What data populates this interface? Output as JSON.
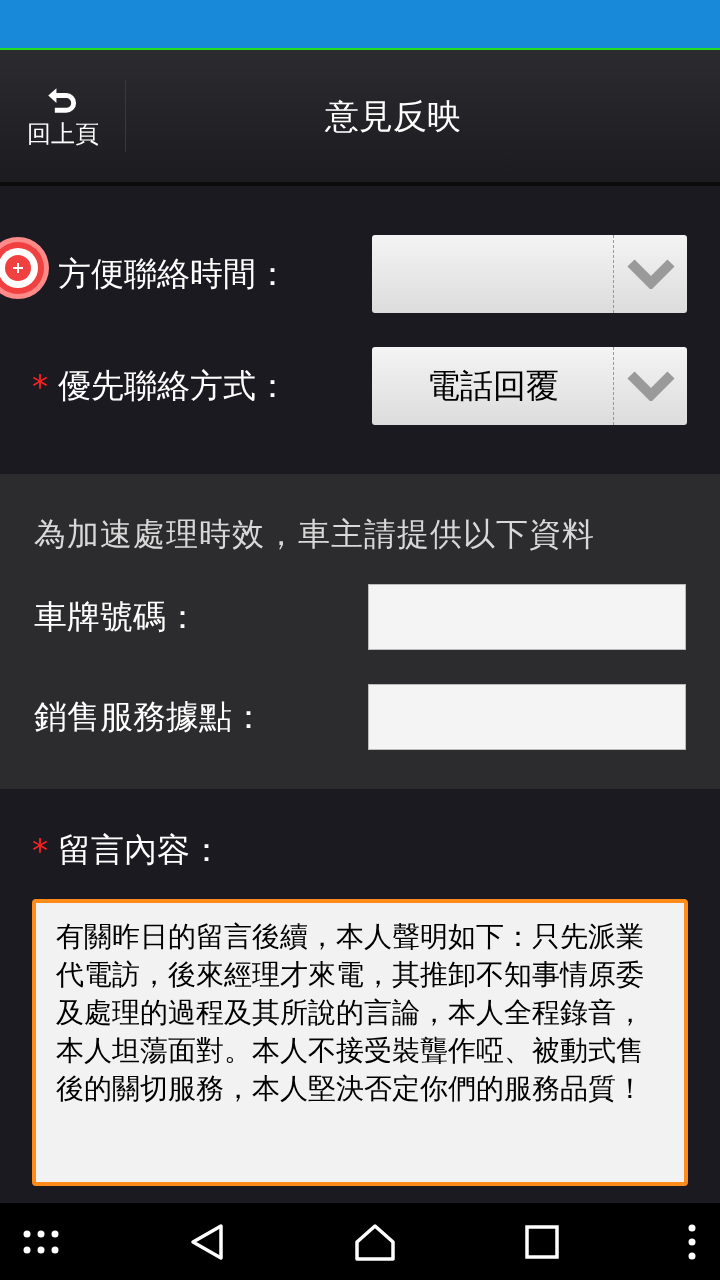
{
  "header": {
    "back_label": "回上頁",
    "title": "意見反映"
  },
  "contact_fields": [
    {
      "label": "方便聯絡時間："
    },
    {
      "label": "優先聯絡方式：",
      "required_marker": "*",
      "value": "電話回覆"
    }
  ],
  "owner_section": {
    "notice": "為加速處理時效，車主請提供以下資料",
    "fields": [
      {
        "label": "車牌號碼："
      },
      {
        "label": "銷售服務據點："
      }
    ]
  },
  "message": {
    "label": "留言內容：",
    "required_marker": "*",
    "focused": true,
    "value": "有關昨日的留言後續，本人聲明如下：只先派業代電訪，後來經理才來電，其推卸不知事情原委及處理的過程及其所說的言論，本人全程錄音，本人坦蕩面對。本人不接受裝聾作啞、被動式售後的關切服務，本人堅決否定你們的服務品質！"
  }
}
